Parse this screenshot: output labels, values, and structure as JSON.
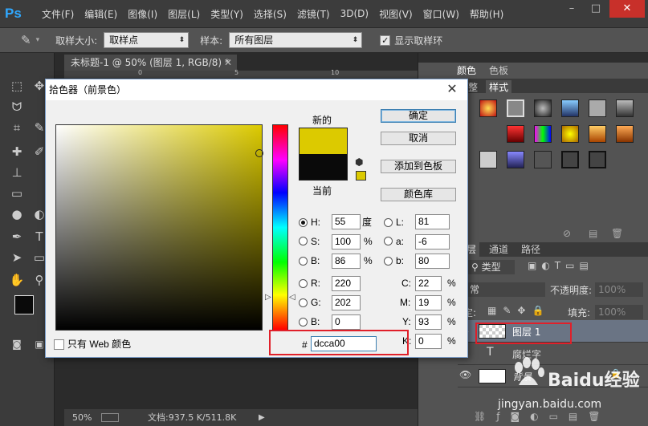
{
  "app": {
    "logo": "Ps",
    "menus": [
      "文件(F)",
      "编辑(E)",
      "图像(I)",
      "图层(L)",
      "类型(Y)",
      "选择(S)",
      "滤镜(T)",
      "3D(D)",
      "视图(V)",
      "窗口(W)",
      "帮助(H)"
    ]
  },
  "options": {
    "sample_size_label": "取样大小:",
    "sample_size_value": "取样点",
    "sample_label": "样本:",
    "sample_value": "所有图层",
    "show_ring_label": "显示取样环"
  },
  "document": {
    "tab_title": "未标题-1 @ 50% (图层 1, RGB/8) *",
    "ruler_marks": [
      "0",
      "5",
      "10"
    ],
    "zoom": "50%",
    "doc_info": "文档:937.5 K/511.8K"
  },
  "panels": {
    "color_tabs": [
      "颜色",
      "色板"
    ],
    "style_tabs": [
      "整",
      "样式"
    ],
    "layer_tabs": [
      "层",
      "通道",
      "路径"
    ],
    "kind_label": "类型",
    "blend_mode": "常",
    "opacity_label": "不透明度:",
    "opacity_value": "100%",
    "lock_label": "定:",
    "fill_label": "填充:",
    "fill_value": "100%"
  },
  "layers": [
    {
      "name": "图层 1",
      "type": "pixel"
    },
    {
      "name": "腐烂字",
      "type": "text"
    },
    {
      "name": "背景",
      "type": "background"
    }
  ],
  "dialog": {
    "title": "拾色器（前景色）",
    "new_label": "新的",
    "current_label": "当前",
    "new_color": "#dcca00",
    "current_color": "#0a0a0a",
    "buttons": {
      "ok": "确定",
      "cancel": "取消",
      "add_swatch": "添加到色板",
      "color_library": "颜色库"
    },
    "fields": {
      "H": {
        "label": "H:",
        "value": "55",
        "unit": "度"
      },
      "S": {
        "label": "S:",
        "value": "100",
        "unit": "%"
      },
      "B": {
        "label": "B:",
        "value": "86",
        "unit": "%"
      },
      "R": {
        "label": "R:",
        "value": "220"
      },
      "G": {
        "label": "G:",
        "value": "202"
      },
      "Bb": {
        "label": "B:",
        "value": "0"
      },
      "L": {
        "label": "L:",
        "value": "81"
      },
      "a": {
        "label": "a:",
        "value": "-6"
      },
      "b": {
        "label": "b:",
        "value": "80"
      },
      "C": {
        "label": "C:",
        "value": "22",
        "unit": "%"
      },
      "M": {
        "label": "M:",
        "value": "19",
        "unit": "%"
      },
      "Y": {
        "label": "Y:",
        "value": "93",
        "unit": "%"
      },
      "K": {
        "label": "K:",
        "value": "0",
        "unit": "%"
      }
    },
    "hex_label": "#",
    "hex_value": "dcca00",
    "web_only_label": "只有 Web 颜色"
  },
  "watermark": {
    "brand": "Baidu经验",
    "url": "jingyan.baidu.com"
  }
}
